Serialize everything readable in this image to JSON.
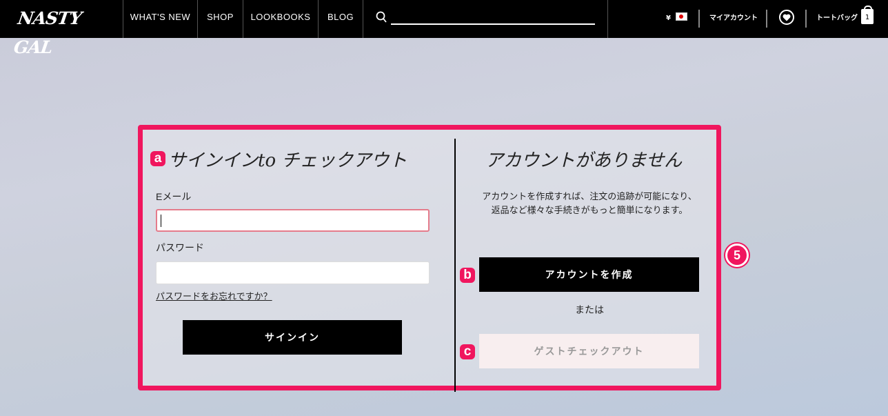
{
  "header": {
    "logo_text": "NASTY GAL",
    "nav": [
      "WHAT'S NEW",
      "SHOP",
      "LOOKBOOKS",
      "BLOG"
    ],
    "search_placeholder": "",
    "currency": "¥",
    "account_label": "マイアカウント",
    "bag_label": "トートバッグ",
    "bag_count": "1"
  },
  "signin": {
    "marker": "a",
    "heading": "サインインto チェックアウト",
    "email_label": "Eメール",
    "email_value": "",
    "password_label": "パスワード",
    "password_value": "",
    "forgot_link": "パスワードをお忘れですか？",
    "signin_button": "サインイン"
  },
  "register": {
    "heading": "アカウントがありません",
    "description": "アカウントを作成すれば、注文の追跡が可能になり、返品など様々な手続きがもっと簡単になります。",
    "marker_b": "b",
    "create_button": "アカウントを作成",
    "or_text": "または",
    "marker_c": "c",
    "guest_button": "ゲストチェックアウト"
  },
  "annotation_number": "5",
  "colors": {
    "header_bg": "#000000",
    "highlight": "#f0165e",
    "guest_button_bg": "#f8eeef"
  }
}
